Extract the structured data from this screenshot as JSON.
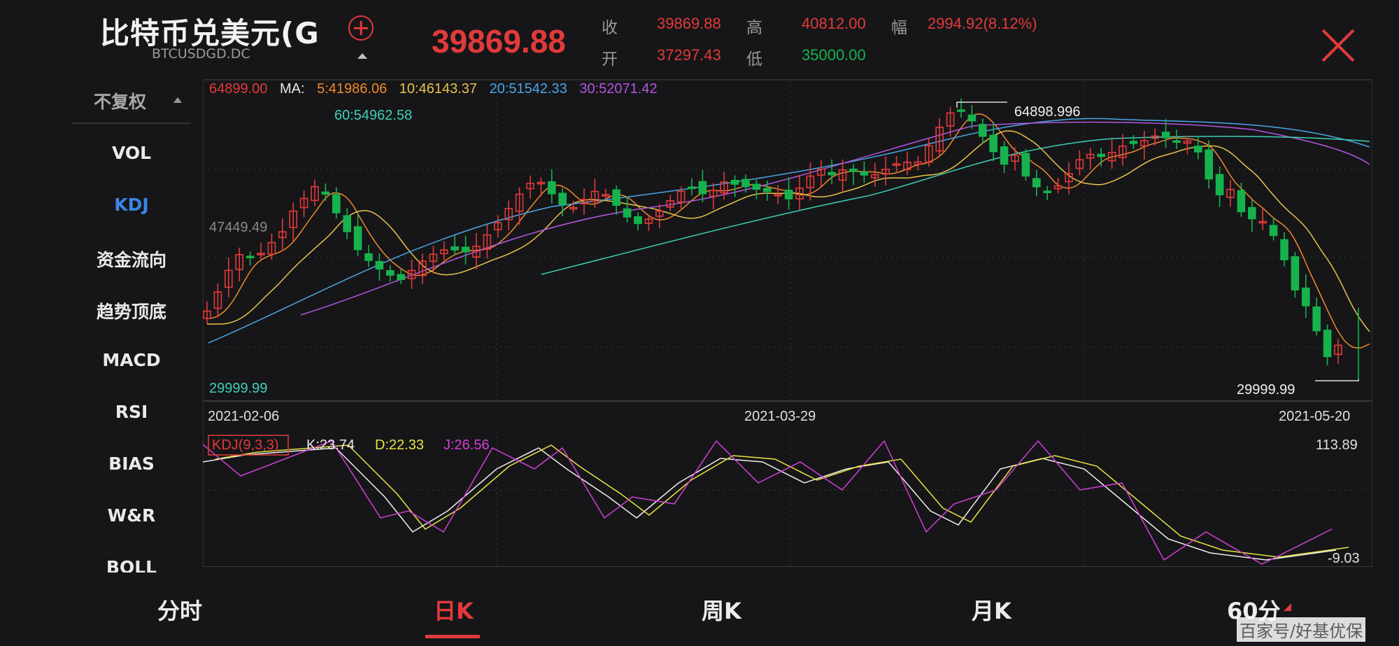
{
  "header": {
    "title": "比特币兑美元(G",
    "symbol": "BTCUSDGD.DC",
    "price": "39869.88",
    "quote": [
      {
        "label": "收",
        "value": "39869.88",
        "color": "#e23a3a"
      },
      {
        "label": "开",
        "value": "37297.43",
        "color": "#e23a3a"
      },
      {
        "label": "高",
        "value": "40812.00",
        "color": "#e23a3a"
      },
      {
        "label": "低",
        "value": "35000.00",
        "color": "#17b24d"
      },
      {
        "label": "幅",
        "value": "2994.92(8.12%)",
        "color": "#e23a3a"
      }
    ]
  },
  "left_menu": {
    "adjust": "不复权",
    "items": [
      "VOL",
      "KDJ",
      "资金流向",
      "趋势顶底",
      "MACD",
      "RSI",
      "BIAS",
      "W&R",
      "BOLL"
    ],
    "active": "KDJ"
  },
  "main_chart": {
    "ma_legend": [
      {
        "text": "64899.00",
        "color": "#e23a3a"
      },
      {
        "text": "MA:",
        "color": "#e8e8e8"
      },
      {
        "text": "5:41986.06",
        "color": "#f08a2c"
      },
      {
        "text": "10:46143.37",
        "color": "#e8c34a"
      },
      {
        "text": "20:51542.33",
        "color": "#4aa6e8"
      },
      {
        "text": "30:52071.42",
        "color": "#b455e0"
      },
      {
        "text": "60:54962.58",
        "color": "#3fcfb7"
      }
    ],
    "y_max": "64899.00",
    "y_mid": "47449.49",
    "y_min": "29999.99",
    "high_marker": "64898.996",
    "low_marker": "29999.99",
    "dates": [
      "2021-02-06",
      "2021-03-29",
      "2021-05-20"
    ]
  },
  "kdj_chart": {
    "tag": "KDJ(9,3,3)",
    "k_label": "K:23.74",
    "d_label": "D:22.33",
    "j_label": "J:26.56",
    "y_max": "113.89",
    "y_min": "-9.03"
  },
  "colors": {
    "up": "#e23a3a",
    "down": "#17b24d",
    "accent": "#3b84e8"
  },
  "tabs": [
    "分时",
    "日K",
    "周K",
    "月K",
    "60分"
  ],
  "active_tab": "日K",
  "watermark": "百家号/好基优保"
}
